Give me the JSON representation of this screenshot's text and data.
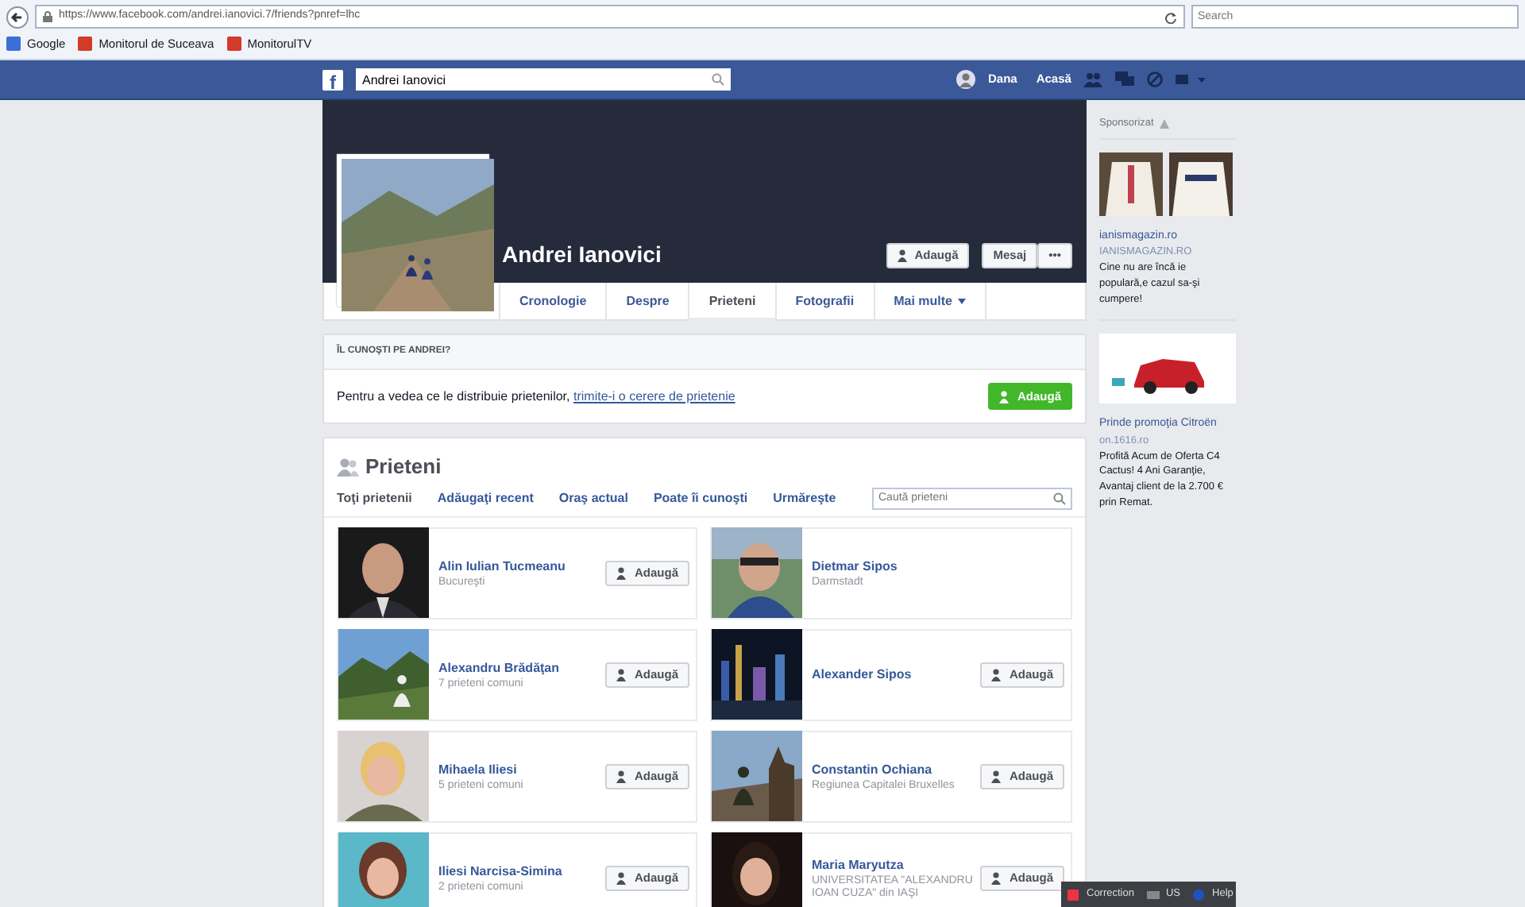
{
  "browser": {
    "url": "https://www.facebook.com/andrei.ianovici.7/friends?pnref=lhc",
    "search_placeholder": "Search",
    "bookmarks": [
      {
        "label": "Google",
        "color": "#3b6fd8"
      },
      {
        "label": "Monitorul de Suceava",
        "color": "#d23a2a"
      },
      {
        "label": "MonitorulTV",
        "color": "#d23a2a"
      }
    ]
  },
  "nav": {
    "logo": "f",
    "search_value": "Andrei Ianovici",
    "user": "Dana",
    "home": "Acasă"
  },
  "profile": {
    "name": "Andrei Ianovici",
    "add": "Adaugă",
    "message": "Mesaj",
    "more": "•••",
    "tabs": [
      {
        "label": "Cronologie",
        "selected": false
      },
      {
        "label": "Despre",
        "selected": false
      },
      {
        "label": "Prieteni",
        "selected": true
      },
      {
        "label": "Fotografii",
        "selected": false
      },
      {
        "label": "Mai multe",
        "selected": false
      }
    ]
  },
  "suggest": {
    "heading": "ÎL CUNOŞTI PE ANDREI?",
    "text": "Pentru a vedea ce le distribuie prietenilor,",
    "link": "trimite-i o cerere de prietenie",
    "button": "Adaugă"
  },
  "friends": {
    "title": "Prieteni",
    "search_placeholder": "Caută prieteni",
    "filters": [
      {
        "label": "Toţi prietenii",
        "selected": true
      },
      {
        "label": "Adăugaţi recent",
        "selected": false
      },
      {
        "label": "Oraş actual",
        "selected": false
      },
      {
        "label": "Poate îi cunoşti",
        "selected": false
      },
      {
        "label": "Urmăreşte",
        "selected": false
      }
    ],
    "items": [
      {
        "name": "Alin Iulian Tucmeanu",
        "detail": "Bucureşti",
        "button": "Adaugă"
      },
      {
        "name": "Dietmar Sipos",
        "detail": "Darmstadt"
      },
      {
        "name": "Alexandru Brădăţan",
        "detail": "7 prieteni comuni",
        "button": "Adaugă"
      },
      {
        "name": "Alexander Sipos",
        "button": "Adaugă"
      },
      {
        "name": "Mihaela Iliesi",
        "detail": "5 prieteni comuni",
        "button": "Adaugă"
      },
      {
        "name": "Constantin Ochiana",
        "detail": "Regiunea Capitalei Bruxelles",
        "button": "Adaugă"
      },
      {
        "name": "Iliesi Narcisa-Simina",
        "detail": "2 prieteni comuni",
        "button": "Adaugă"
      },
      {
        "name": "Maria Maryutza",
        "detail": "UNIVERSITATEA \"ALEXANDRU IOAN CUZA\" din IAŞI",
        "button": "Adaugă"
      }
    ]
  },
  "sidebar": {
    "heading": "Sponsorizat",
    "ads": [
      {
        "title": "ianismagazin.ro",
        "subtitle": "IANISMAGAZIN.RO",
        "text": "Cine nu are încă ie populară,e cazul sa-şi cumpere!"
      },
      {
        "title": "Prinde promoţia Citroën",
        "subtitle": "on.1616.ro",
        "text": "Profită Acum de Oferta C4 Cactus! 4 Ani Garanţie, Avantaj client de la 2.700 € prin Remat."
      }
    ]
  },
  "language_bar": [
    {
      "label": "Correction"
    },
    {
      "label": "US"
    },
    {
      "label": "Help"
    }
  ]
}
